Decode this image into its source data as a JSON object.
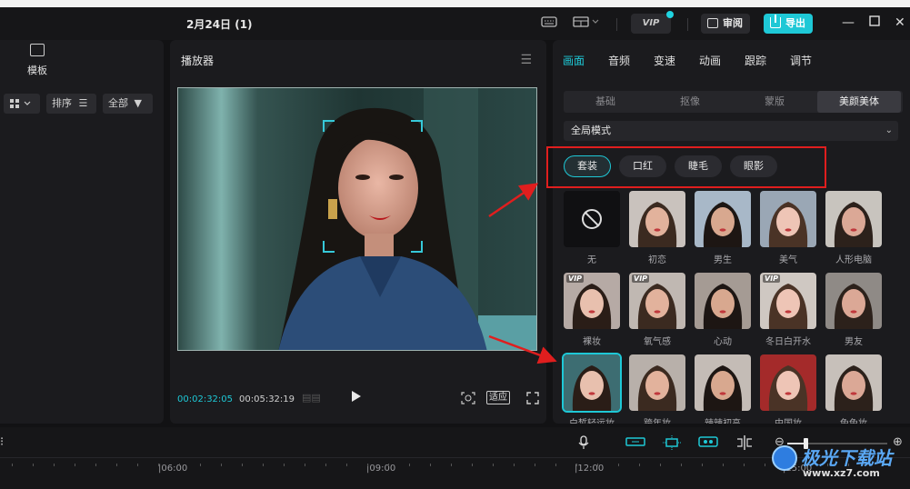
{
  "window": {
    "title": "2月24日 (1)"
  },
  "header": {
    "vip_label": "VIP",
    "review_label": "审阅",
    "export_label": "导出"
  },
  "left_panel": {
    "template_label": "模板",
    "sort_label": "排序",
    "filter_label": "全部"
  },
  "player": {
    "title": "播放器",
    "current_time": "00:02:32:05",
    "total_time": "00:05:32:19",
    "fit_label": "适应"
  },
  "right_panel": {
    "tabs": [
      "画面",
      "音频",
      "变速",
      "动画",
      "跟踪",
      "调节"
    ],
    "active_tab": 0,
    "subtabs": [
      "基础",
      "抠像",
      "蒙版",
      "美颜美体"
    ],
    "active_subtab": 3,
    "mode": "全局模式",
    "categories": [
      "套装",
      "口红",
      "睫毛",
      "眼影"
    ],
    "active_category": 0,
    "presets": [
      {
        "label": "无",
        "vip": false
      },
      {
        "label": "初恋",
        "vip": false
      },
      {
        "label": "男生",
        "vip": false
      },
      {
        "label": "美气",
        "vip": false
      },
      {
        "label": "人形电脑",
        "vip": false
      },
      {
        "label": "裸妆",
        "vip": true
      },
      {
        "label": "氧气感",
        "vip": true
      },
      {
        "label": "心动",
        "vip": false
      },
      {
        "label": "冬日白开水",
        "vip": true
      },
      {
        "label": "男友",
        "vip": false
      },
      {
        "label": "白皙轻运妆",
        "vip": false
      },
      {
        "label": "跨年妆",
        "vip": false
      },
      {
        "label": "辣辣初高",
        "vip": false
      },
      {
        "label": "中国妆",
        "vip": false
      },
      {
        "label": "兔兔妆",
        "vip": false
      }
    ],
    "selected_preset": 10
  },
  "timeline": {
    "ruler": [
      "|06:00",
      "|09:00",
      "|12:00",
      "|15:00"
    ]
  },
  "watermark": {
    "text": "极光下载站",
    "url": "www.xz7.com"
  },
  "colors": {
    "accent": "#1ec8d6",
    "highlight": "#e01e1e",
    "panel": "#1b1b1e"
  }
}
